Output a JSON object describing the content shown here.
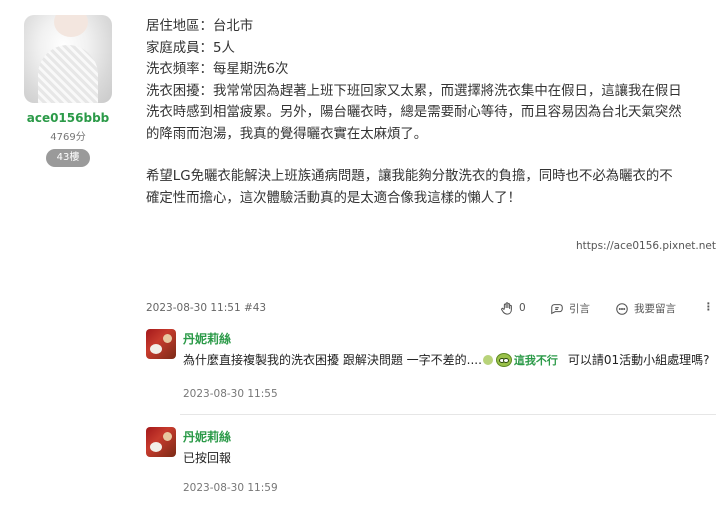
{
  "author": {
    "username": "ace0156bbb",
    "points": "4769分",
    "floor": "43樓"
  },
  "post": {
    "lines": [
      "居住地區：台北市",
      "家庭成員：5人",
      "洗衣頻率：每星期洗6次",
      "洗衣困擾：我常常因為趕著上班下班回家又太累，而選擇將洗衣集中在假日，這讓我在假日",
      "洗衣時感到相當疲累。另外，陽台曬衣時，總是需要耐心等待，而且容易因為台北天氣突然",
      "的降雨而泡湯，我真的覺得曬衣實在太麻煩了。",
      "希望LG免曬衣能解決上班族通病問題，讓我能夠分散洗衣的負擔，同時也不必為曬衣的不",
      "確定性而擔心，這次體驗活動真的是太適合像我這樣的懶人了！"
    ],
    "source": "https://ace0156.pixnet.net"
  },
  "meta": {
    "date": "2023-08-30 11:51 #43",
    "like_count": "0",
    "quote_label": "引言",
    "reply_label": "我要留言",
    "more": "⋮"
  },
  "comments": [
    {
      "name": "丹妮莉絲",
      "text_before": "為什麼直接複製我的洗衣困擾 跟解決問題 一字不差的....",
      "emoji_text": "這我不行",
      "text_after": "可以請01活動小組處理嗎?",
      "date": "2023-08-30 11:55"
    },
    {
      "name": "丹妮莉絲",
      "text": "已按回報",
      "date": "2023-08-30 11:59"
    }
  ],
  "icons": {
    "like": "clap-icon",
    "quote": "quote-icon",
    "reply": "chat-icon",
    "more": "more-vertical-icon"
  },
  "colors": {
    "username_green": "#2b9a48",
    "badge_gray": "#9a9a9a"
  }
}
